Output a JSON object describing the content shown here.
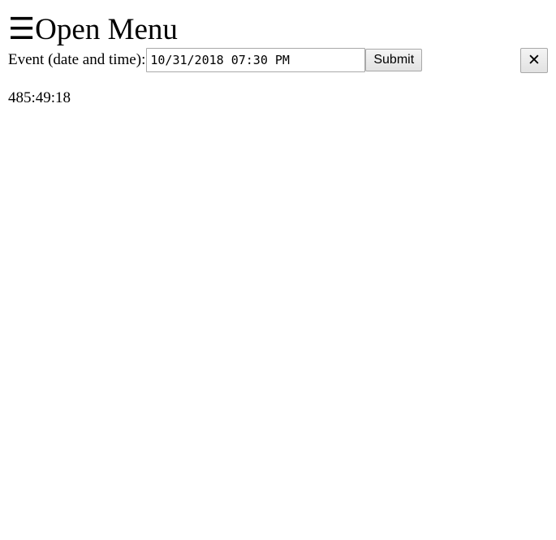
{
  "menu": {
    "icon": "hamburger-icon",
    "icon_glyph": "☰",
    "label": "Open Menu"
  },
  "form": {
    "label": "Event (date and time):",
    "datetime_value": "10/31/2018 07:30 PM",
    "submit_label": "Submit"
  },
  "close": {
    "icon": "close-icon",
    "glyph": "✕"
  },
  "countdown": {
    "value": "485:49:18"
  }
}
